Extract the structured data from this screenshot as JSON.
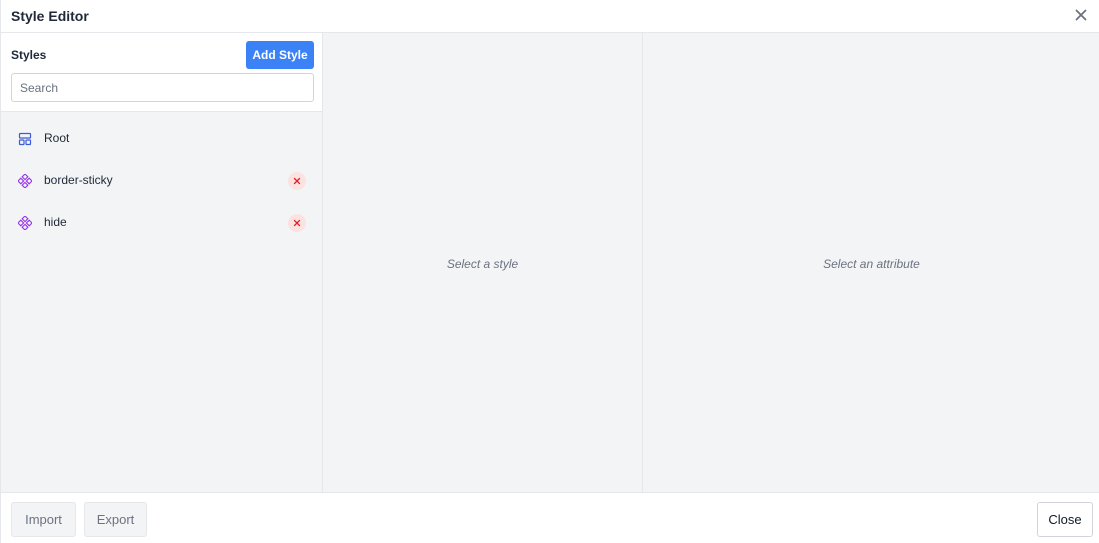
{
  "header": {
    "title": "Style Editor",
    "close_icon": "close-icon"
  },
  "styles_panel": {
    "label": "Styles",
    "add_button": "Add Style",
    "search_placeholder": "Search",
    "items": [
      {
        "label": "Root",
        "icon": "layout-icon",
        "deletable": false
      },
      {
        "label": "border-sticky",
        "icon": "component-icon",
        "deletable": true
      },
      {
        "label": "hide",
        "icon": "component-icon",
        "deletable": true
      }
    ]
  },
  "middle_panel": {
    "placeholder": "Select a style"
  },
  "right_panel": {
    "placeholder": "Select an attribute"
  },
  "footer": {
    "import_label": "Import",
    "export_label": "Export",
    "close_label": "Close"
  },
  "colors": {
    "accent": "#3b82f6",
    "component_icon": "#9333ea",
    "layout_icon": "#3b5bdb",
    "delete_bg": "#fde2e2",
    "delete_fg": "#dc2626"
  }
}
